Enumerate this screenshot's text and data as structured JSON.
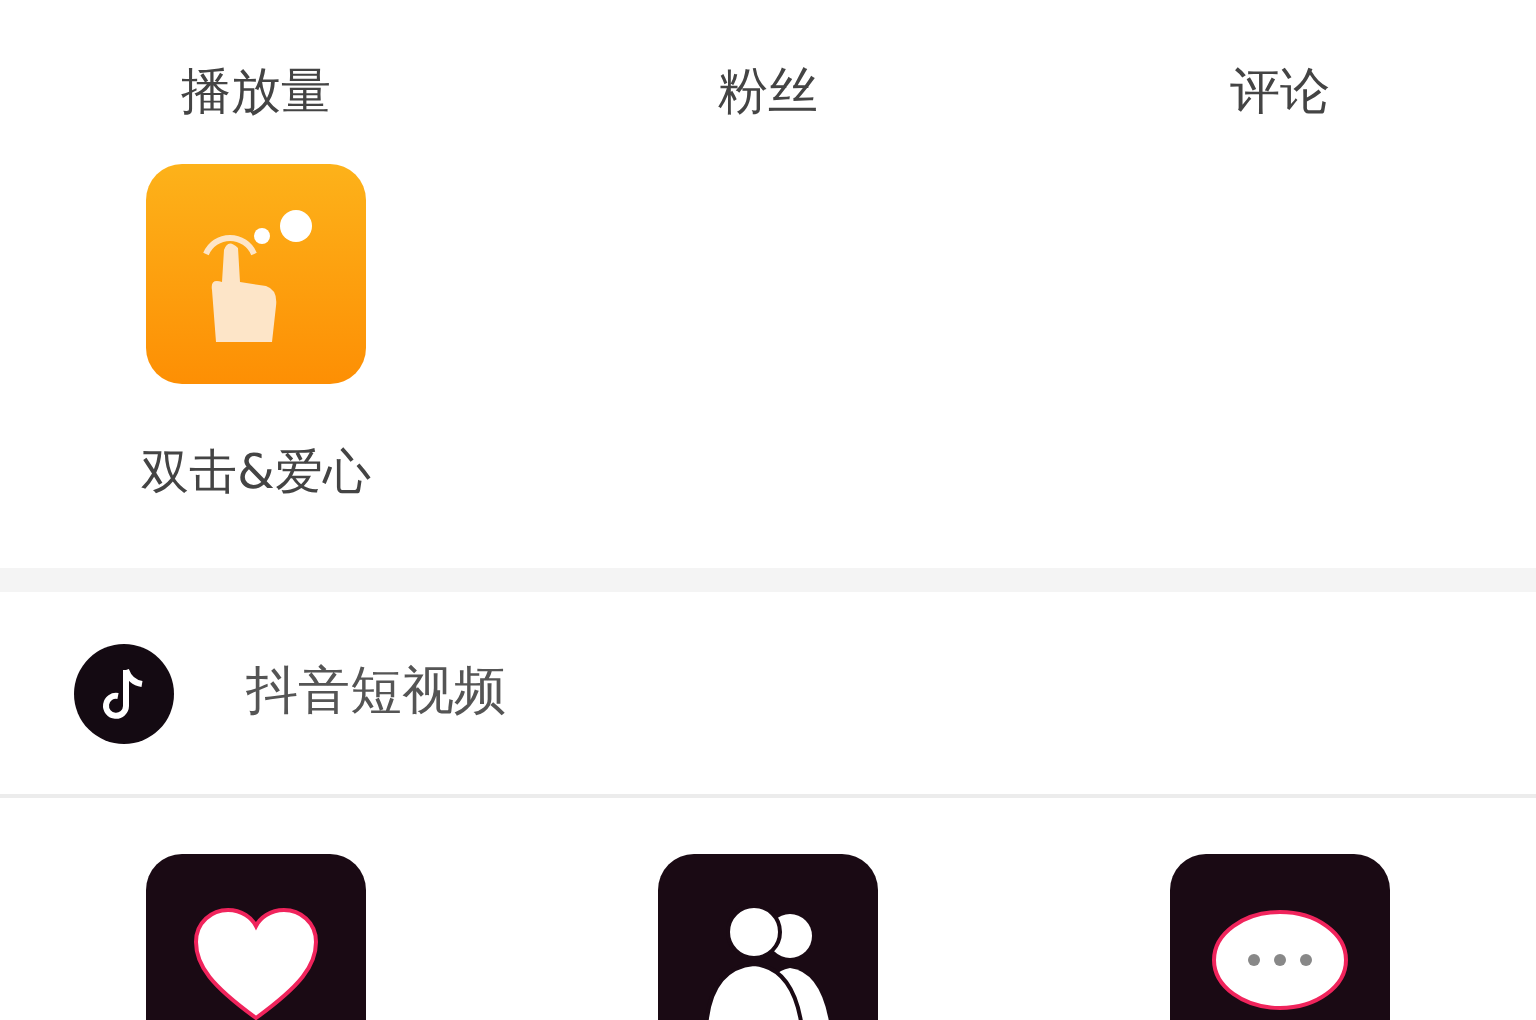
{
  "stat_labels": [
    "播放量",
    "粉丝",
    "评论"
  ],
  "actions": [
    {
      "label": "双击&爱心",
      "kind": "double-tap"
    }
  ],
  "section": {
    "title": "抖音短视频"
  },
  "section_items": [
    {
      "kind": "heart"
    },
    {
      "kind": "people"
    },
    {
      "kind": "chat"
    }
  ]
}
